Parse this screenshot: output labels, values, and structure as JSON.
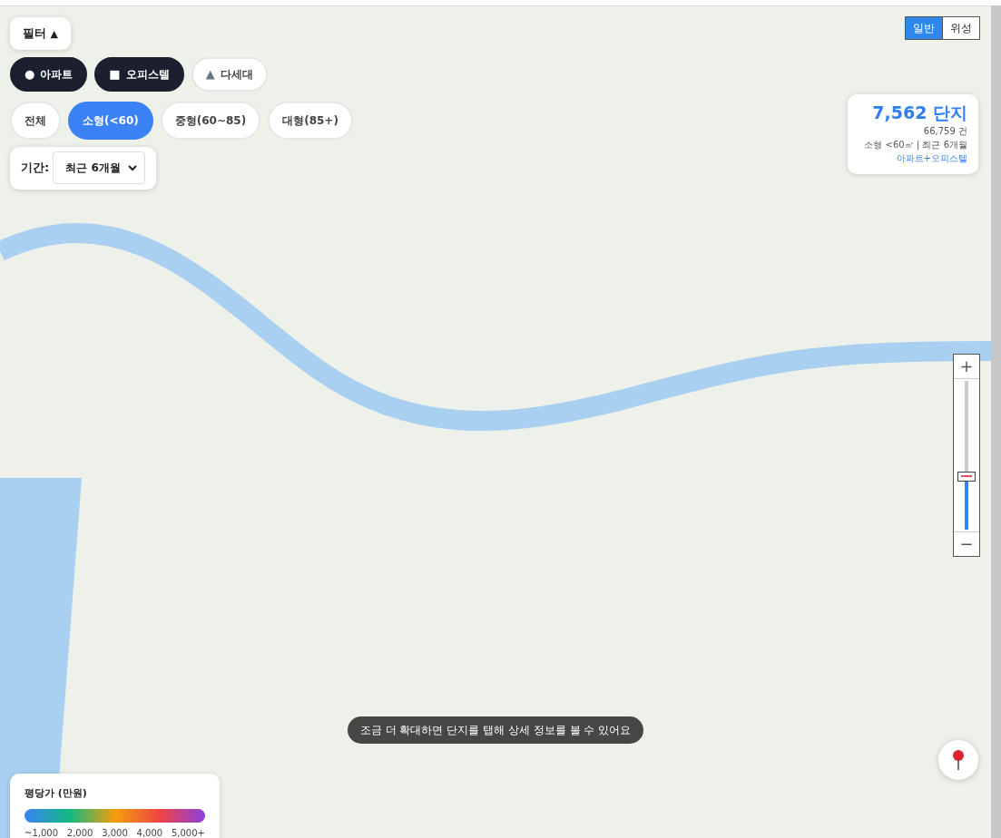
{
  "filter_toggle": {
    "label": "필터",
    "icon": "▲",
    "expanded": true
  },
  "property_types": [
    {
      "label": "아파트",
      "icon": "●",
      "selected": true
    },
    {
      "label": "오피스텔",
      "icon": "■",
      "selected": true
    },
    {
      "label": "다세대",
      "icon": "▲",
      "selected": false
    }
  ],
  "sizes": [
    {
      "label": "전체",
      "selected": false
    },
    {
      "label": "소형(<60)",
      "selected": true
    },
    {
      "label": "중형(60~85)",
      "selected": false
    },
    {
      "label": "대형(85+)",
      "selected": false
    }
  ],
  "period": {
    "label": "기간:",
    "value": "최근 6개월"
  },
  "map_types": [
    {
      "label": "일반",
      "selected": true
    },
    {
      "label": "위성",
      "selected": false
    }
  ],
  "summary": {
    "count": "7,562 단지",
    "trades": "66,759 건",
    "criteria": "소형 <60㎡ | 최근 6개월",
    "types": "아파트+오피스텔"
  },
  "zoom": {
    "plus": "+",
    "minus": "−",
    "level": 0.35
  },
  "legend": {
    "title": "평당가 (만원)",
    "ticks": [
      "~1,000",
      "2,000",
      "3,000",
      "4,000",
      "5,000+"
    ]
  },
  "toast": "조금 더 확대하면 단지를 탭해 상세 정보를 볼 수 있어요"
}
